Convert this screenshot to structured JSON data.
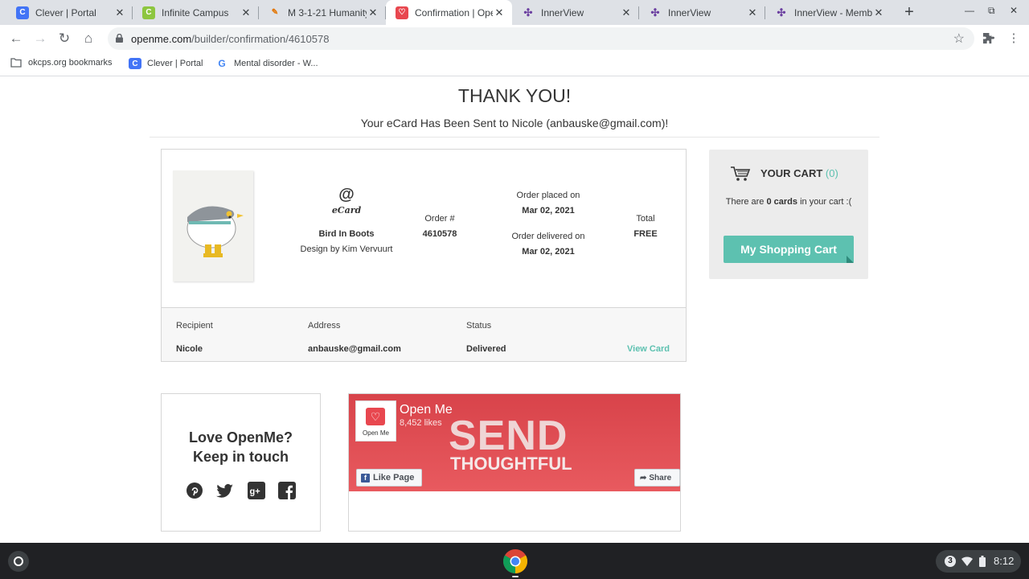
{
  "browser": {
    "tabs": [
      {
        "title": "Clever | Portal",
        "icon": "clever-icon",
        "color": "#4274f6",
        "letter": "C"
      },
      {
        "title": "Infinite Campus",
        "icon": "infinite-campus-icon",
        "color": "#8dc63f",
        "letter": "C"
      },
      {
        "title": "M 3-1-21 Humanity",
        "icon": "doc-icon",
        "color": "#e37400",
        "letter": "M"
      },
      {
        "title": "Confirmation | Ope",
        "icon": "openme-icon",
        "color": "#e8474f",
        "letter": "♡",
        "active": true
      },
      {
        "title": "InnerView",
        "icon": "innerview-icon",
        "color": "#6b3fa0",
        "letter": "✣"
      },
      {
        "title": "InnerView",
        "icon": "innerview-icon",
        "color": "#6b3fa0",
        "letter": "✣"
      },
      {
        "title": "InnerView - Membe",
        "icon": "innerview-icon",
        "color": "#6b3fa0",
        "letter": "✣"
      }
    ],
    "tab_close": "✕",
    "new_tab": "+",
    "url_host": "openme.com",
    "url_path": "/builder/confirmation/4610578",
    "bookmarks": [
      {
        "label": "okcps.org bookmarks",
        "icon": "folder-icon"
      },
      {
        "label": "Clever | Portal",
        "icon": "clever-icon"
      },
      {
        "label": "Mental disorder - W...",
        "icon": "google-icon"
      }
    ]
  },
  "page": {
    "heading": "THANK YOU!",
    "sent_message": "Your eCard Has Been Sent to Nicole (anbauske@gmail.com)!",
    "order": {
      "card_type_symbol": "@",
      "card_type": "eCard",
      "card_name": "Bird In Boots",
      "designer": "Design by Kim Vervuurt",
      "order_no_label": "Order #",
      "order_no": "4610578",
      "placed_label": "Order placed on",
      "placed_date": "Mar 02, 2021",
      "delivered_label": "Order delivered on",
      "delivered_date": "Mar 02, 2021",
      "total_label": "Total",
      "total": "FREE",
      "recipient_label": "Recipient",
      "recipient": "Nicole",
      "address_label": "Address",
      "address": "anbauske@gmail.com",
      "status_label": "Status",
      "status": "Delivered",
      "view_card": "View Card"
    },
    "cart": {
      "title": "YOUR CART",
      "count": "(0)",
      "text_pre": "There are ",
      "text_bold": "0 cards",
      "text_post": " in your cart :(",
      "button": "My Shopping Cart"
    },
    "social": {
      "title_line1": "Love OpenMe?",
      "title_line2": "Keep in touch",
      "icons": [
        "pinterest-icon",
        "twitter-icon",
        "google-plus-icon",
        "facebook-icon"
      ]
    },
    "facebook": {
      "page_name": "Open Me",
      "likes": "8,452 likes",
      "banner_line1": "SEND",
      "banner_line2": "THOUGHTFUL",
      "logo_text": "Open Me",
      "like_button": "Like Page",
      "share_button": "Share"
    }
  },
  "shelf": {
    "notification_count": "3",
    "time": "8:12"
  },
  "colors": {
    "accent": "#5dc1b0",
    "brand_red": "#e8474f"
  }
}
